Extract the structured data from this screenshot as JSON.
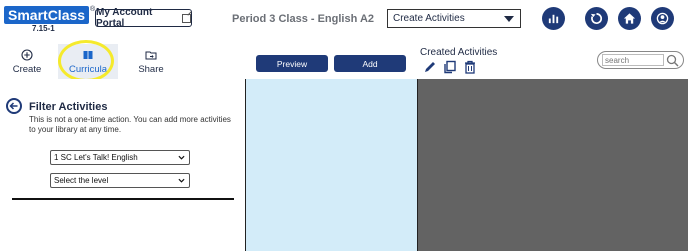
{
  "logo": {
    "smart": "Smart",
    "class": "Class",
    "reg": "®",
    "version": "7.15-1"
  },
  "header": {
    "portal_label": "My Account Portal",
    "class_title": "Period 3 Class - English A2",
    "activity_select": "Create Activities",
    "icons": [
      "stats-icon",
      "refresh-icon",
      "home-icon",
      "user-icon"
    ]
  },
  "tabs": [
    {
      "label": "Create",
      "icon": "plus-circle-icon"
    },
    {
      "label": "Curricula",
      "icon": "book-icon",
      "active": true
    },
    {
      "label": "Share",
      "icon": "folder-share-icon"
    }
  ],
  "toolbar": {
    "preview_label": "Preview",
    "add_label": "Add",
    "created_label": "Created Activities",
    "search_placeholder": "search"
  },
  "filter": {
    "title": "Filter Activities",
    "note": "This is not a one-time action. You can add more activities to your library at any time.",
    "curriculum_value": "1 SC Let's Talk! English",
    "level_value": "Select the level"
  },
  "colors": {
    "navy": "#1f3a78",
    "brand_blue": "#1b66c9",
    "highlight": "#f5ea2c",
    "preview_bg": "#d3ecf9",
    "dark_bg": "#636363"
  }
}
